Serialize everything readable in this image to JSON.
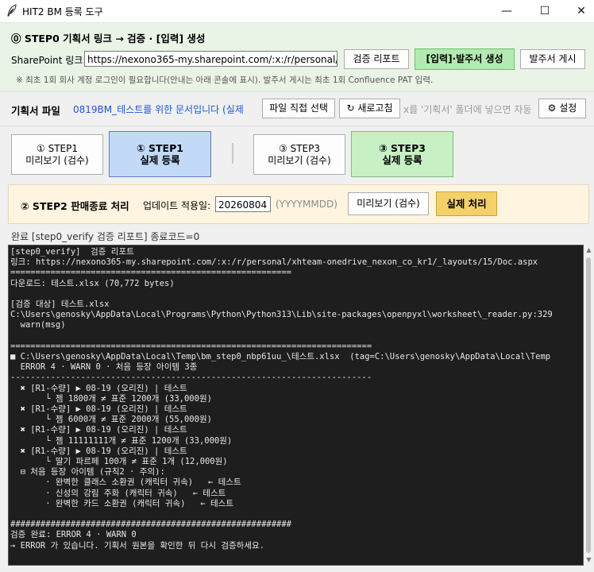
{
  "window": {
    "title": "HIT2 BM 등록 도구",
    "minimize": "—",
    "maximize": "☐",
    "close": "✕"
  },
  "step0": {
    "heading": "⓪ STEP0  기획서 링크 → 검증 · [입력] 생성",
    "sharepoint_label": "SharePoint 링크:",
    "sharepoint_value": "https://nexono365-my.sharepoint.com/:x:/r/personal/xhteam-",
    "verify_report_btn": "검증 리포트",
    "generate_btn": "[입력]·발주서 생성",
    "publish_btn": "발주서 게시",
    "note": "※ 최초 1회 회사 계정 로그인이 필요합니다(안내는 아래 콘솔에 표시). 발주서 게시는 최초 1회 Confluence PAT 입력."
  },
  "planfile": {
    "label": "기획서 파일",
    "filename": "0819BM_테스트를 위한 문서입니다 (실제",
    "choose_btn": "파일 직접 선택",
    "refresh_btn": "↻ 새로고침",
    "hint": "x를 '기획서' 폴더에 넣으면 자동 ",
    "settings_btn": "⚙ 설정"
  },
  "steps": {
    "s1_preview": "① STEP1\n미리보기 (검수)",
    "s1_real": "① STEP1\n실제 등록",
    "s3_preview": "③ STEP3\n미리보기 (검수)",
    "s3_real": "③ STEP3\n실제 등록"
  },
  "step2": {
    "heading": "② STEP2  판매종료 처리",
    "date_label": "업데이트 적용일:",
    "date_value": "20260804",
    "date_hint": "(YYYYMMDD)",
    "preview_btn": "미리보기 (검수)",
    "execute_btn": "실제 처리"
  },
  "status_line": "완료  [step0_verify  검증 리포트]  종료코드=0",
  "console_lines": [
    "[step0_verify]  검증 리포트",
    "링크: https://nexono365-my.sharepoint.com/:x:/r/personal/xhteam-onedrive_nexon_co_kr1/_layouts/15/Doc.aspx",
    "========================================================",
    "다운로드: 테스트.xlsx (70,772 bytes)",
    "",
    "[검증 대상] 테스트.xlsx",
    "C:\\Users\\genosky\\AppData\\Local\\Programs\\Python\\Python313\\Lib\\site-packages\\openpyxl\\worksheet\\_reader.py:329",
    "  warn(msg)",
    "",
    "========================================================================",
    "■ C:\\Users\\genosky\\AppData\\Local\\Temp\\bm_step0_nbp61uu_\\테스트.xlsx  (tag=C:\\Users\\genosky\\AppData\\Local\\Temp",
    "  ERROR 4 · WARN 0 · 처음 등장 아이템 3종",
    "------------------------------------------------------------------------",
    "  ✖ [R1-수량] ▶ 08-19 (오리진) | 테스트",
    "       └ 젬 1800개 ≠ 표준 1200개 (33,000원)",
    "  ✖ [R1-수량] ▶ 08-19 (오리진) | 테스트",
    "       └ 젬 6000개 ≠ 표준 2000개 (55,000원)",
    "  ✖ [R1-수량] ▶ 08-19 (오리진) | 테스트",
    "       └ 젬 11111111개 ≠ 표준 1200개 (33,000원)",
    "  ✖ [R1-수량] ▶ 08-19 (오리진) | 테스트",
    "       └ 딸기 파르페 100개 ≠ 표준 1개 (12,000원)",
    "  ⊟ 처음 등장 아이템 (규칙2 · 주의):",
    "       · 완벽한 클래스 소환권 (캐릭터 귀속)   ← 테스트",
    "       · 신성의 강림 주화 (캐릭터 귀속)   ← 테스트",
    "       · 완벽한 카드 소환권 (캐릭터 귀속)   ← 테스트",
    "",
    "########################################################",
    "검증 완료: ERROR 4 · WARN 0",
    "→ ERROR 가 있습니다. 기획서 원본을 확인한 뒤 다시 검증하세요."
  ],
  "colors": {
    "step0_bg": "#e9f4e7",
    "generate_btn": "#b3eab1",
    "step1_real": "#c2d9f7",
    "step3_real": "#c7f0c4",
    "step2_bg": "#fff4e0",
    "execute_btn": "#f4d06a",
    "console_bg": "#1e1e1e",
    "link_blue": "#1a56d6"
  }
}
